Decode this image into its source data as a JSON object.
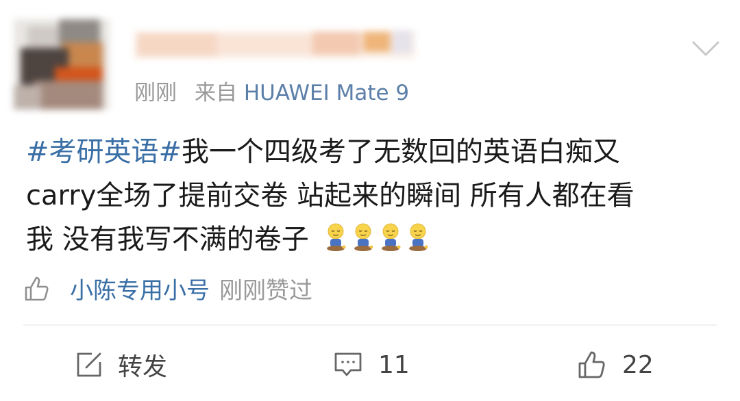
{
  "post": {
    "meta": {
      "time": "刚刚",
      "device_prefix": "来自",
      "device": "HUAWEI Mate 9"
    },
    "content": {
      "hashtag": "#考研英语#",
      "line1": "我一个四级考了无数回的英语白痴又",
      "line2": "carry全场了提前交卷 站起来的瞬间 所有人都在看",
      "line3": "我 没有我写不满的卷子",
      "emojis": [
        "kneeling-emoji",
        "kneeling-emoji",
        "kneeling-emoji",
        "kneeling-emoji"
      ]
    },
    "liked_by": {
      "user": "小陈专用小号",
      "note": "刚刚赞过"
    },
    "actions": {
      "repost_label": "转发",
      "comment_count": "11",
      "like_count": "22"
    },
    "icons": {
      "more": "chevron-down-icon",
      "liked_by": "thumb-up-outline-icon",
      "repost": "share-edit-icon",
      "comment": "comment-icon",
      "like": "thumb-up-icon"
    },
    "colors": {
      "link": "#3a6fa6",
      "device": "#5b7fa8",
      "secondary_text": "#999999",
      "primary_text": "#1a1a1a"
    }
  }
}
